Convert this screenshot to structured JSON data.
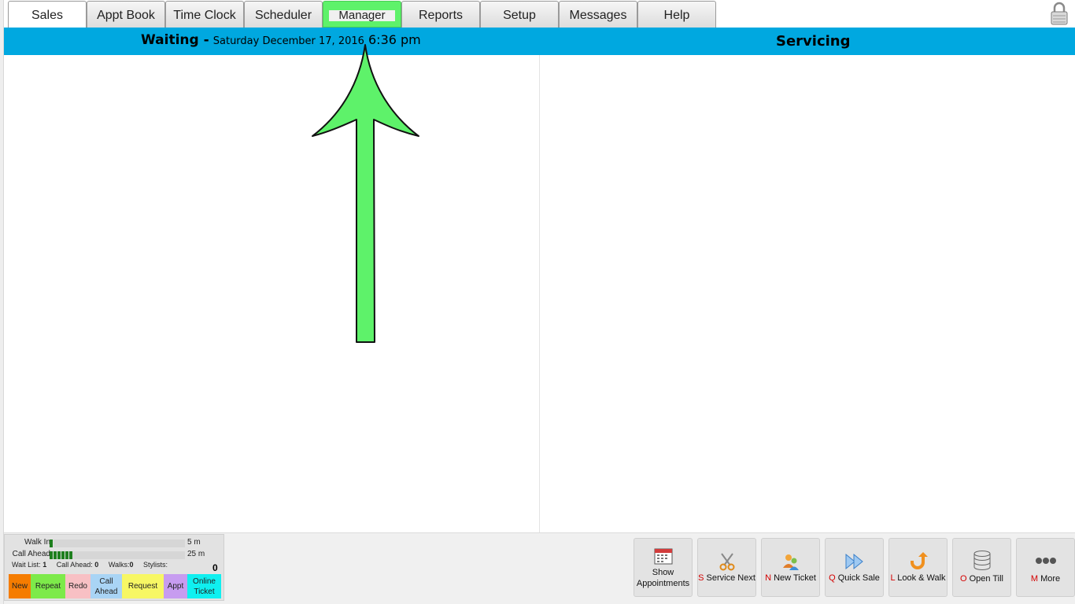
{
  "tabs": [
    {
      "label": "Sales",
      "state": "active"
    },
    {
      "label": "Appt Book"
    },
    {
      "label": "Time Clock"
    },
    {
      "label": "Scheduler"
    },
    {
      "label": "Manager",
      "state": "highlighted"
    },
    {
      "label": "Reports"
    },
    {
      "label": "Setup"
    },
    {
      "label": "Messages"
    },
    {
      "label": "Help"
    }
  ],
  "header": {
    "waiting_title": "Waiting -",
    "date": "Saturday December 17, 2016",
    "time": "6:36 pm",
    "servicing_title": "Servicing"
  },
  "wait_status": {
    "walk_in_label": "Walk In",
    "walk_in_fill": 0.03,
    "walk_in_time": "5 m",
    "call_ahead_label": "Call Ahead",
    "call_ahead_fill": 0.17,
    "call_ahead_time": "25 m",
    "wait_list_label": "Wait List:",
    "wait_list_value": "1",
    "call_ahead_count_label": "Call Ahead:",
    "call_ahead_count_value": "0",
    "walks_label": "Walks:",
    "walks_value": "0",
    "stylists_label": "Stylists:",
    "stylists_count": "0"
  },
  "legend": [
    {
      "label": "New",
      "color": "#f57c00"
    },
    {
      "label": "Repeat",
      "color": "#7dea4a"
    },
    {
      "label": "Redo",
      "color": "#f8c0c4"
    },
    {
      "label": "Call Ahead",
      "color": "#a9d4f5"
    },
    {
      "label": "Request",
      "color": "#f7f764"
    },
    {
      "label": "Appt",
      "color": "#c79cf0"
    },
    {
      "label": "Online Ticket",
      "color": "#0ff0f0"
    }
  ],
  "actions": [
    {
      "key": "",
      "label": "Show Appointments",
      "icon": "calendar-icon"
    },
    {
      "key": "S",
      "label": "Service Next",
      "icon": "scissors-icon"
    },
    {
      "key": "N",
      "label": "New Ticket",
      "icon": "people-icon"
    },
    {
      "key": "Q",
      "label": "Quick Sale",
      "icon": "fast-forward-icon"
    },
    {
      "key": "L",
      "label": "Look & Walk",
      "icon": "u-turn-arrow-icon"
    },
    {
      "key": "O",
      "label": "Open Till",
      "icon": "coin-stack-icon"
    },
    {
      "key": "M",
      "label": "More",
      "icon": "ellipsis-icon"
    }
  ],
  "colors": {
    "header_bar": "#00a8e0",
    "annotation_arrow": "#5ef26a",
    "shortcut_key": "#d40000"
  }
}
